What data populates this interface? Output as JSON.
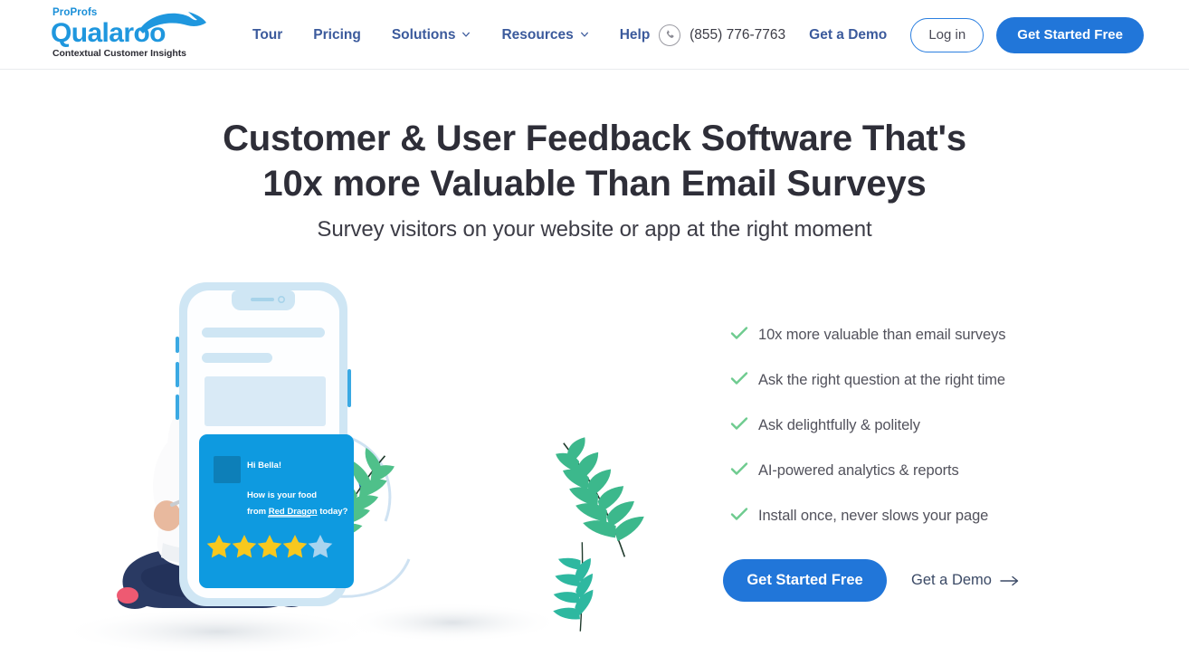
{
  "header": {
    "logo": {
      "proprofs": "ProProfs",
      "brand": "Qualaroo",
      "tagline": "Contextual Customer Insights",
      "brand_color": "#1f97de"
    },
    "nav": [
      {
        "label": "Tour",
        "has_caret": false
      },
      {
        "label": "Pricing",
        "has_caret": false
      },
      {
        "label": "Solutions",
        "has_caret": true
      },
      {
        "label": "Resources",
        "has_caret": true
      },
      {
        "label": "Help",
        "has_caret": false
      }
    ],
    "phone": "(855) 776-7763",
    "demo_link": "Get a Demo",
    "login_label": "Log in",
    "cta_label": "Get Started Free",
    "accent_color": "#2176d9",
    "nav_color": "#3b5a9c"
  },
  "hero": {
    "title_line1": "Customer & User Feedback Software That's",
    "title_line2": "10x more Valuable Than Email Surveys",
    "subtitle": "Survey visitors on your website or app at the right moment"
  },
  "features": {
    "check_color": "#6ecb8f",
    "items": [
      "10x more valuable than email surveys",
      "Ask the right question at the right time",
      "Ask delightfully & politely",
      "AI-powered analytics & reports",
      "Install once, never slows your page"
    ]
  },
  "cta": {
    "primary_label": "Get Started Free",
    "secondary_label": "Get a Demo"
  },
  "illustration": {
    "survey_card": {
      "greeting": "Hi Bella!",
      "question_line1": "How is your food",
      "question_line2_prefix": "from ",
      "question_line2_link": "Red Dragon",
      "question_line2_suffix": " today?",
      "stars_filled": 4,
      "stars_total": 5,
      "star_color": "#f7c81e",
      "star_empty_color": "#a9d4ef",
      "card_color": "#0e9ae0"
    },
    "play_button": "play-button",
    "phone_frame_color": "#cfe6f4"
  }
}
